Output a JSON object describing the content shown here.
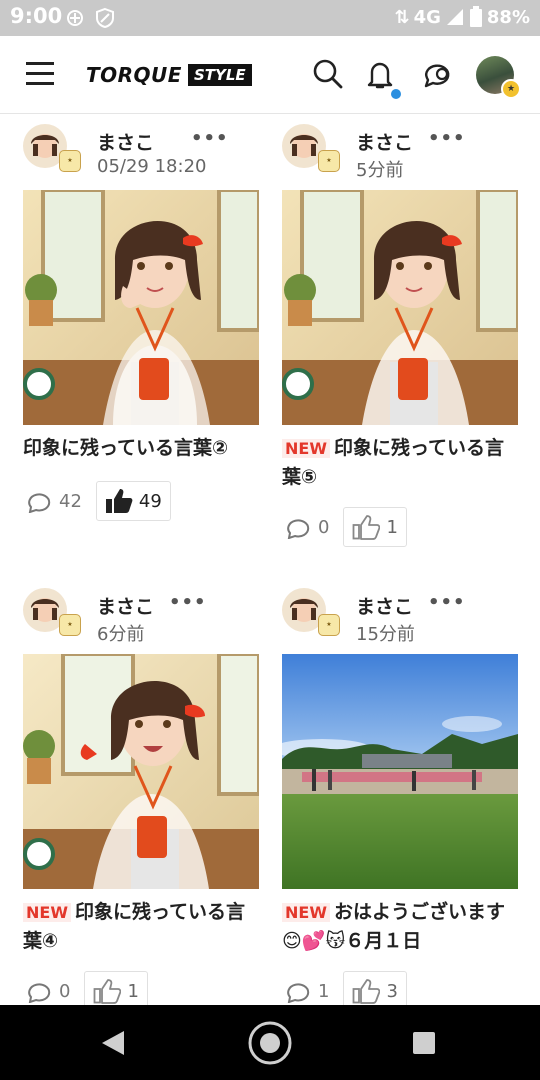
{
  "status_bar": {
    "time": "9:00",
    "network": "4G",
    "battery": "88%",
    "icons": [
      "data-saver-icon",
      "shield-icon",
      "wifi-arrows-icon",
      "signal-icon",
      "battery-icon"
    ]
  },
  "header": {
    "logo_main": "TORQUE",
    "logo_sub": "STYLE",
    "icons": [
      "menu-icon",
      "search-icon",
      "bell-icon",
      "chat-icon",
      "user-avatar"
    ],
    "notification_dot_color": "#2b8fe0"
  },
  "posts": [
    {
      "author": "まさこ",
      "time": "05/29 18:20",
      "more": "•••",
      "is_new": false,
      "new_label": "",
      "title": "印象に残っている言葉②",
      "comments": "42",
      "likes": "49",
      "liked": true,
      "thumbnail": "anime-woman-portrait"
    },
    {
      "author": "まさこ",
      "time": "5分前",
      "more": "•••",
      "is_new": true,
      "new_label": "NEW",
      "title": "印象に残っている言葉⑤",
      "comments": "0",
      "likes": "1",
      "liked": false,
      "thumbnail": "anime-woman-portrait"
    },
    {
      "author": "まさこ",
      "time": "6分前",
      "more": "•••",
      "is_new": true,
      "new_label": "NEW",
      "title": "印象に残っている言葉④",
      "comments": "0",
      "likes": "1",
      "liked": false,
      "thumbnail": "anime-woman-smiling"
    },
    {
      "author": "まさこ",
      "time": "15分前",
      "more": "•••",
      "is_new": true,
      "new_label": "NEW",
      "title": "おはようございます😊💕😽６月１日",
      "comments": "1",
      "likes": "3",
      "liked": false,
      "thumbnail": "park-lawn-photo"
    }
  ],
  "colors": {
    "new_tag": "#e3372b",
    "status_bar": "#c9c9c9",
    "nav_bar": "#000000"
  }
}
